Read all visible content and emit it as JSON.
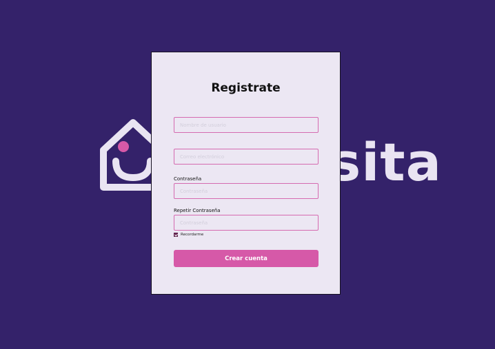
{
  "background": {
    "color": "#34226a",
    "logo_icon": "house-icon",
    "logo_text": "sita"
  },
  "form": {
    "title": "Registrate",
    "fields": [
      {
        "label": "",
        "placeholder": "Nombre de usuario",
        "value": ""
      },
      {
        "label": "",
        "placeholder": "Correo electrónico",
        "value": ""
      },
      {
        "label": "Contraseña",
        "placeholder": "Contraseña",
        "value": ""
      },
      {
        "label": "Repetir Contraseña",
        "placeholder": "Contraseña",
        "value": ""
      }
    ],
    "remember_label": "Recordarme",
    "remember_checked": true,
    "submit_label": "Crear cuenta",
    "accent_color": "#d659a8",
    "input_border_color": "#d56ab0"
  }
}
